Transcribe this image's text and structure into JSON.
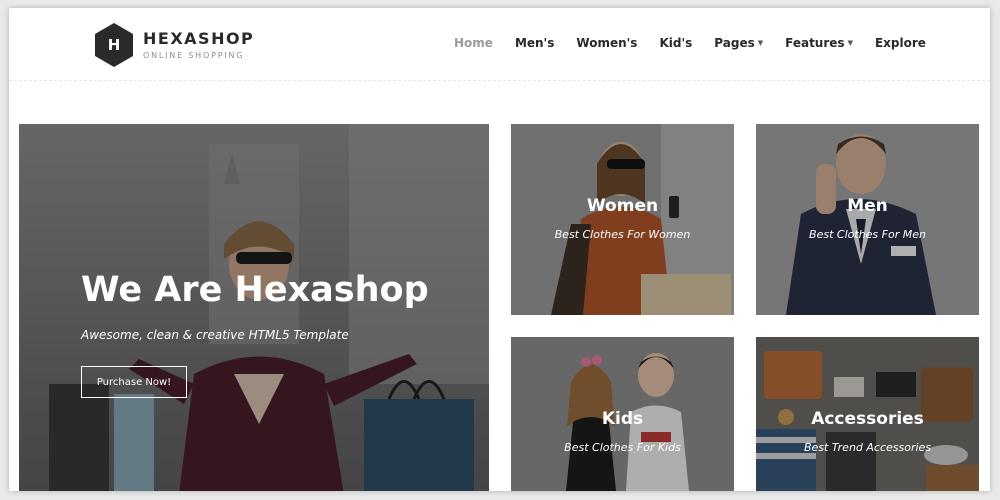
{
  "brand": {
    "name": "HEXASHOP",
    "tagline": "ONLINE SHOPPING",
    "logo_letter": "H"
  },
  "nav": {
    "items": [
      {
        "label": "Home",
        "active": true
      },
      {
        "label": "Men's"
      },
      {
        "label": "Women's"
      },
      {
        "label": "Kid's"
      },
      {
        "label": "Pages",
        "dropdown": true
      },
      {
        "label": "Features",
        "dropdown": true
      },
      {
        "label": "Explore"
      }
    ]
  },
  "hero": {
    "title": "We Are Hexashop",
    "subtitle": "Awesome, clean & creative HTML5 Template",
    "button_label": "Purchase Now!"
  },
  "categories": [
    {
      "title": "Women",
      "subtitle": "Best Clothes For Women"
    },
    {
      "title": "Men",
      "subtitle": "Best Clothes For Men"
    },
    {
      "title": "Kids",
      "subtitle": "Best Clothes For Kids"
    },
    {
      "title": "Accessories",
      "subtitle": "Best Trend Accessories"
    }
  ],
  "colors": {
    "text_dark": "#2a2a2a",
    "nav_active": "#9a9a9a",
    "logo_bg": "#2a2a2a"
  }
}
